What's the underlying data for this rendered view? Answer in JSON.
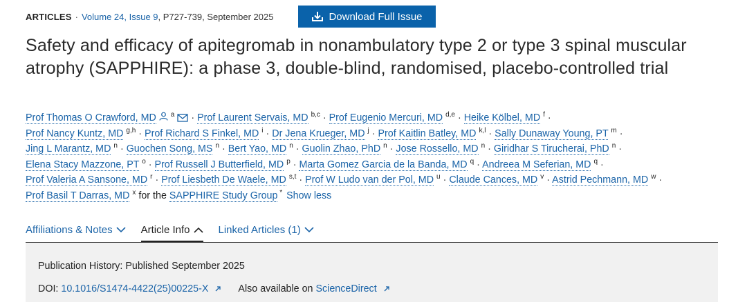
{
  "header": {
    "article_type": "ARTICLES",
    "separator": "·",
    "volume_issue": "Volume 24, Issue 9",
    "pages_date": ", P727-739, September 2025",
    "download_label": "Download Full Issue"
  },
  "title": "Safety and efficacy of apitegromab in nonambulatory type 2 or type 3 spinal muscular atrophy (SAPPHIRE): a phase 3, double-blind, randomised, placebo-controlled trial",
  "authors": [
    {
      "name": "Prof Thomas O Crawford, MD",
      "sup": "a",
      "icons": true
    },
    {
      "name": "Prof Laurent Servais, MD",
      "sup": "b,c"
    },
    {
      "name": "Prof Eugenio Mercuri, MD",
      "sup": "d,e"
    },
    {
      "name": "Heike Kölbel, MD",
      "sup": "f"
    },
    {
      "name": "Prof Nancy Kuntz, MD",
      "sup": "g,h"
    },
    {
      "name": "Prof Richard S Finkel, MD",
      "sup": "i"
    },
    {
      "name": "Dr Jena Krueger, MD",
      "sup": "j"
    },
    {
      "name": "Prof Kaitlin Batley, MD",
      "sup": "k,l"
    },
    {
      "name": "Sally Dunaway Young, PT",
      "sup": "m"
    },
    {
      "name": "Jing L Marantz, MD",
      "sup": "n"
    },
    {
      "name": "Guochen Song, MS",
      "sup": "n"
    },
    {
      "name": "Bert Yao, MD",
      "sup": "n"
    },
    {
      "name": "Guolin Zhao, PhD",
      "sup": "n"
    },
    {
      "name": "Jose Rossello, MD",
      "sup": "n"
    },
    {
      "name": "Giridhar S Tirucherai, PhD",
      "sup": "n"
    },
    {
      "name": "Elena Stacy Mazzone, PT",
      "sup": "o"
    },
    {
      "name": "Prof Russell J Butterfield, MD",
      "sup": "p"
    },
    {
      "name": "Marta Gomez Garcia de la Banda, MD",
      "sup": "q"
    },
    {
      "name": "Andreea M Seferian, MD",
      "sup": "q"
    },
    {
      "name": "Prof Valeria A Sansone, MD",
      "sup": "r"
    },
    {
      "name": "Prof Liesbeth De Waele, MD",
      "sup": "s,t"
    },
    {
      "name": "Prof W Ludo van der Pol, MD",
      "sup": "u"
    },
    {
      "name": "Claude Cances, MD",
      "sup": "v"
    },
    {
      "name": "Astrid Pechmann, MD",
      "sup": "w"
    },
    {
      "name": "Prof Basil T Darras, MD",
      "sup": "x"
    }
  ],
  "author_breaks_after": [
    3,
    8,
    14,
    18,
    23
  ],
  "group": {
    "prefix": "for the",
    "name": "SAPPHIRE Study Group",
    "sup": "*"
  },
  "show_less": "Show less",
  "tabs": [
    {
      "label": "Affiliations & Notes",
      "active": false,
      "chevron": "down"
    },
    {
      "label": "Article Info",
      "active": true,
      "chevron": "up"
    },
    {
      "label": "Linked Articles (1)",
      "active": false,
      "chevron": "down"
    }
  ],
  "info": {
    "history": "Publication History:  Published September 2025",
    "doi_label": "DOI: ",
    "doi_value": "10.1016/S1474-4422(25)00225-X",
    "also_label": "Also available on ",
    "also_link": "ScienceDirect"
  },
  "colors": {
    "link": "#1b64a8",
    "button": "#0a62aa",
    "panel": "#f1f1f1"
  }
}
